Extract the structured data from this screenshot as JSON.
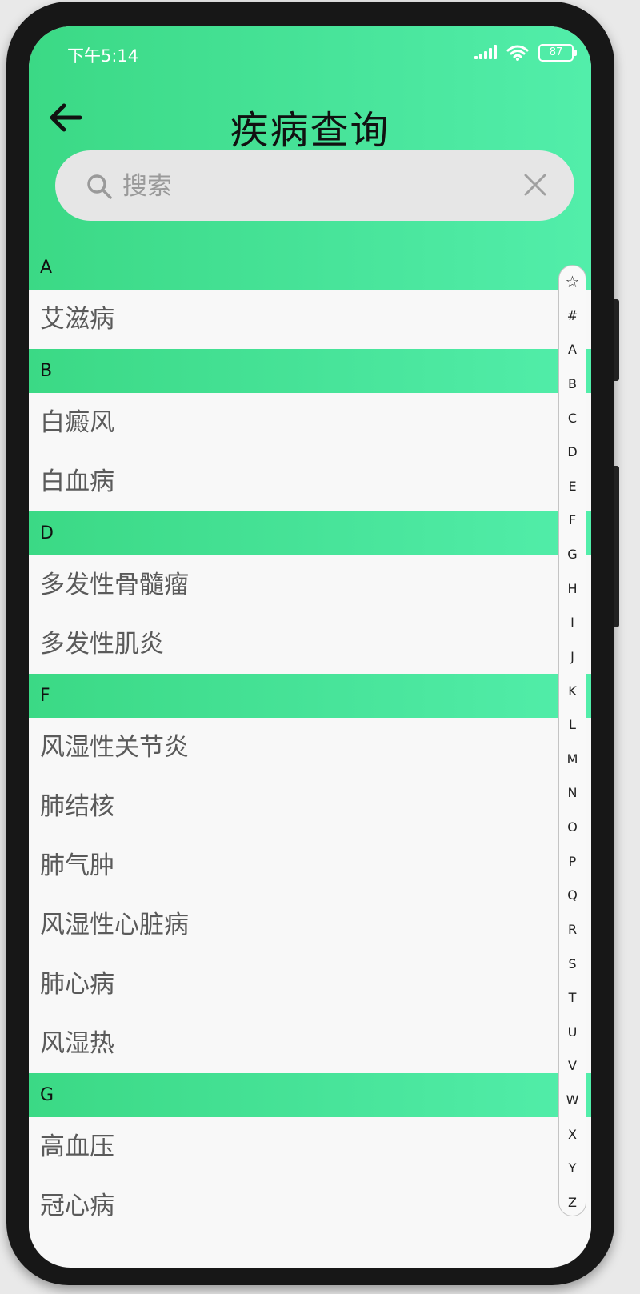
{
  "status_bar": {
    "time": "下午5:14",
    "battery": "87"
  },
  "header": {
    "title": "疾病查询"
  },
  "search": {
    "placeholder": "搜索",
    "value": ""
  },
  "sections": [
    {
      "letter": "A",
      "items": [
        "艾滋病"
      ]
    },
    {
      "letter": "B",
      "items": [
        "白癜风",
        "白血病"
      ]
    },
    {
      "letter": "D",
      "items": [
        "多发性骨髓瘤",
        "多发性肌炎"
      ]
    },
    {
      "letter": "F",
      "items": [
        "风湿性关节炎",
        "肺结核",
        "肺气肿",
        "风湿性心脏病",
        "肺心病",
        "风湿热"
      ]
    },
    {
      "letter": "G",
      "items": [
        "高血压",
        "冠心病"
      ]
    }
  ],
  "index_bar": [
    "☆",
    "#",
    "A",
    "B",
    "C",
    "D",
    "E",
    "F",
    "G",
    "H",
    "I",
    "J",
    "K",
    "L",
    "M",
    "N",
    "O",
    "P",
    "Q",
    "R",
    "S",
    "T",
    "U",
    "V",
    "W",
    "X",
    "Y",
    "Z"
  ],
  "colors": {
    "accent_green": "#48e49a",
    "list_bg": "#f8f8f8",
    "text_gray": "#5a5a5a"
  }
}
